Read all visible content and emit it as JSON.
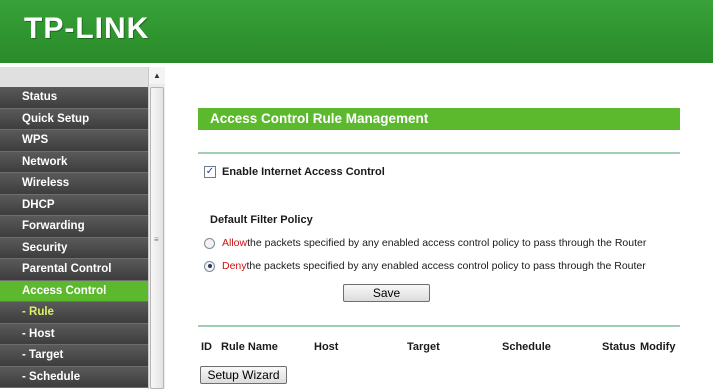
{
  "brand": {
    "logo_text": "TP-LINK"
  },
  "colors": {
    "header_green": "#3aa23a",
    "accent_green": "#5cb82c",
    "menu_dark": "#444444",
    "deny_red": "#cc1111"
  },
  "sidebar": {
    "items": [
      {
        "label": "Status"
      },
      {
        "label": "Quick Setup"
      },
      {
        "label": "WPS"
      },
      {
        "label": "Network"
      },
      {
        "label": "Wireless"
      },
      {
        "label": "DHCP"
      },
      {
        "label": "Forwarding"
      },
      {
        "label": "Security"
      },
      {
        "label": "Parental Control"
      },
      {
        "label": "Access Control"
      },
      {
        "label": "- Rule"
      },
      {
        "label": "- Host"
      },
      {
        "label": "- Target"
      },
      {
        "label": "- Schedule"
      }
    ],
    "active_item": "Access Control",
    "selected_sub_item": "- Rule"
  },
  "main": {
    "title": "Access Control Rule Management",
    "enable_checkbox": {
      "label": "Enable Internet Access Control",
      "checked": true
    },
    "default_filter_policy": {
      "heading": "Default Filter Policy",
      "options": [
        {
          "keyword": "Allow",
          "text": " the packets specified by any enabled access control policy to pass through the Router",
          "checked": false
        },
        {
          "keyword": "Deny",
          "text": " the packets specified by any enabled access control policy to pass through the Router",
          "checked": true
        }
      ]
    },
    "save_label": "Save",
    "table": {
      "columns": [
        "ID",
        "Rule Name",
        "Host",
        "Target",
        "Schedule",
        "Status",
        "Modify"
      ]
    },
    "wizard_label": "Setup Wizard"
  },
  "icons": {
    "scroll_up": "triangle-up-icon",
    "scroll_grip": "grip-icon",
    "check": "check-icon"
  }
}
